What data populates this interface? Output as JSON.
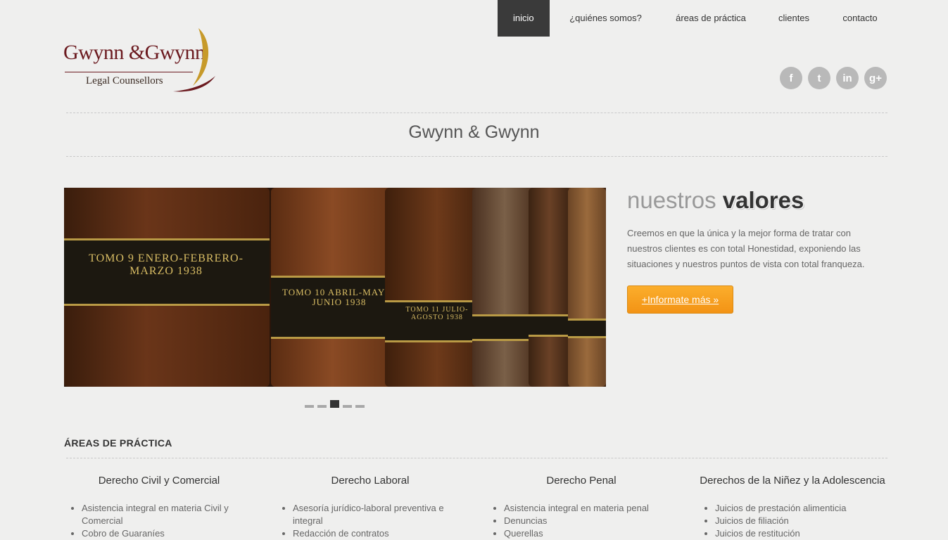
{
  "nav": {
    "items": [
      "inicio",
      "¿quiénes somos?",
      "áreas de práctica",
      "clientes",
      "contacto"
    ]
  },
  "logo": {
    "brand": "Gwynn &Gwynn",
    "tagline": "Legal Counsellors"
  },
  "social": [
    "f",
    "t",
    "in",
    "g+"
  ],
  "site_title": "Gwynn & Gwynn",
  "slider": {
    "labels": [
      "TOMO 9 ENERO-FEBRERO-MARZO 1938",
      "TOMO 10 ABRIL-MAYO-JUNIO 1938",
      "TOMO 11 JULIO-AGOSTO 1938"
    ],
    "active_dot": 3,
    "dot_count": 5
  },
  "values": {
    "title_light": "nuestros",
    "title_bold": "valores",
    "text": "Creemos en que la única y la mejor forma de tratar con nuestros clientes es con total Honestidad, exponiendo las situaciones y nuestros puntos de vista con total franqueza.",
    "button": "+Informate más »"
  },
  "areas": {
    "heading": "ÁREAS DE PRÁCTICA",
    "columns": [
      {
        "title": "Derecho Civil y Comercial",
        "items": [
          "Asistencia integral en materia Civil y Comercial",
          "Cobro de Guaraníes"
        ]
      },
      {
        "title": "Derecho Laboral",
        "items": [
          "Asesoría jurídico-laboral preventiva e integral",
          "Redacción de contratos"
        ]
      },
      {
        "title": "Derecho Penal",
        "items": [
          "Asistencia integral en materia penal",
          "Denuncias",
          "Querellas"
        ]
      },
      {
        "title": "Derechos de la Niñez y la Adolescencia",
        "items": [
          "Juicios de prestación alimenticia",
          "Juicios de filiación",
          "Juicios de restitución"
        ]
      }
    ]
  }
}
